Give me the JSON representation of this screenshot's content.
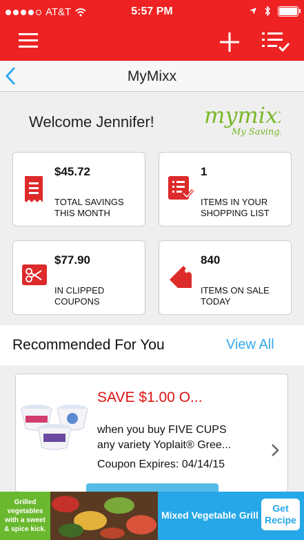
{
  "status": {
    "carrier": "AT&T",
    "time": "5:57 PM"
  },
  "appbar": {
    "menu_icon": "hamburger-menu-icon",
    "add_icon": "plus-icon",
    "list_icon": "checklist-icon"
  },
  "nav": {
    "title": "MyMixx",
    "back_icon": "chevron-left-icon"
  },
  "welcome": {
    "text": "Welcome Jennifer!",
    "logo_main": "mymixx",
    "logo_sub": "My Savings"
  },
  "stats": [
    {
      "value": "$45.72",
      "label": "TOTAL SAVINGS\nTHIS MONTH",
      "icon": "receipt-icon"
    },
    {
      "value": "1",
      "label": "ITEMS IN YOUR\nSHOPPING LIST",
      "icon": "shopping-list-icon"
    },
    {
      "value": "$77.90",
      "label": "IN CLIPPED\nCOUPONS",
      "icon": "scissors-icon"
    },
    {
      "value": "840",
      "label": "ITEMS ON SALE\nTODAY",
      "icon": "price-tag-icon"
    }
  ],
  "recommended": {
    "title": "Recommended For You",
    "view_all": "View All",
    "coupon": {
      "headline": "SAVE $1.00 O...",
      "desc_line1": "when you buy FIVE CUPS",
      "desc_line2": "any variety Yoplait® Gree...",
      "expires": "Coupon Expires: 04/14/15"
    }
  },
  "ad": {
    "left_text_1": "Grilled",
    "left_text_2": "vegetables",
    "left_text_3": "with a sweet",
    "left_text_4": "& spice kick.",
    "title": "Mixed Vegetable Grill",
    "button_line1": "Get",
    "button_line2": "Recipe"
  },
  "colors": {
    "brand_red": "#ee2222",
    "link_blue": "#33aaee",
    "ad_blue": "#25a7e8",
    "ad_green": "#6ab82e"
  }
}
